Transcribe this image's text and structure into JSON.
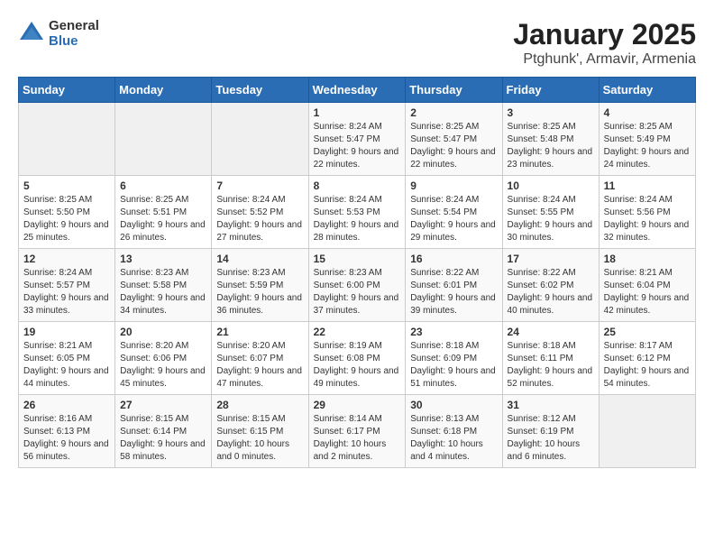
{
  "header": {
    "logo": {
      "general": "General",
      "blue": "Blue"
    },
    "title": "January 2025",
    "subtitle": "Ptghunk', Armavir, Armenia"
  },
  "weekdays": [
    "Sunday",
    "Monday",
    "Tuesday",
    "Wednesday",
    "Thursday",
    "Friday",
    "Saturday"
  ],
  "weeks": [
    [
      {
        "day": "",
        "info": ""
      },
      {
        "day": "",
        "info": ""
      },
      {
        "day": "",
        "info": ""
      },
      {
        "day": "1",
        "info": "Sunrise: 8:24 AM\nSunset: 5:47 PM\nDaylight: 9 hours and 22 minutes."
      },
      {
        "day": "2",
        "info": "Sunrise: 8:25 AM\nSunset: 5:47 PM\nDaylight: 9 hours and 22 minutes."
      },
      {
        "day": "3",
        "info": "Sunrise: 8:25 AM\nSunset: 5:48 PM\nDaylight: 9 hours and 23 minutes."
      },
      {
        "day": "4",
        "info": "Sunrise: 8:25 AM\nSunset: 5:49 PM\nDaylight: 9 hours and 24 minutes."
      }
    ],
    [
      {
        "day": "5",
        "info": "Sunrise: 8:25 AM\nSunset: 5:50 PM\nDaylight: 9 hours and 25 minutes."
      },
      {
        "day": "6",
        "info": "Sunrise: 8:25 AM\nSunset: 5:51 PM\nDaylight: 9 hours and 26 minutes."
      },
      {
        "day": "7",
        "info": "Sunrise: 8:24 AM\nSunset: 5:52 PM\nDaylight: 9 hours and 27 minutes."
      },
      {
        "day": "8",
        "info": "Sunrise: 8:24 AM\nSunset: 5:53 PM\nDaylight: 9 hours and 28 minutes."
      },
      {
        "day": "9",
        "info": "Sunrise: 8:24 AM\nSunset: 5:54 PM\nDaylight: 9 hours and 29 minutes."
      },
      {
        "day": "10",
        "info": "Sunrise: 8:24 AM\nSunset: 5:55 PM\nDaylight: 9 hours and 30 minutes."
      },
      {
        "day": "11",
        "info": "Sunrise: 8:24 AM\nSunset: 5:56 PM\nDaylight: 9 hours and 32 minutes."
      }
    ],
    [
      {
        "day": "12",
        "info": "Sunrise: 8:24 AM\nSunset: 5:57 PM\nDaylight: 9 hours and 33 minutes."
      },
      {
        "day": "13",
        "info": "Sunrise: 8:23 AM\nSunset: 5:58 PM\nDaylight: 9 hours and 34 minutes."
      },
      {
        "day": "14",
        "info": "Sunrise: 8:23 AM\nSunset: 5:59 PM\nDaylight: 9 hours and 36 minutes."
      },
      {
        "day": "15",
        "info": "Sunrise: 8:23 AM\nSunset: 6:00 PM\nDaylight: 9 hours and 37 minutes."
      },
      {
        "day": "16",
        "info": "Sunrise: 8:22 AM\nSunset: 6:01 PM\nDaylight: 9 hours and 39 minutes."
      },
      {
        "day": "17",
        "info": "Sunrise: 8:22 AM\nSunset: 6:02 PM\nDaylight: 9 hours and 40 minutes."
      },
      {
        "day": "18",
        "info": "Sunrise: 8:21 AM\nSunset: 6:04 PM\nDaylight: 9 hours and 42 minutes."
      }
    ],
    [
      {
        "day": "19",
        "info": "Sunrise: 8:21 AM\nSunset: 6:05 PM\nDaylight: 9 hours and 44 minutes."
      },
      {
        "day": "20",
        "info": "Sunrise: 8:20 AM\nSunset: 6:06 PM\nDaylight: 9 hours and 45 minutes."
      },
      {
        "day": "21",
        "info": "Sunrise: 8:20 AM\nSunset: 6:07 PM\nDaylight: 9 hours and 47 minutes."
      },
      {
        "day": "22",
        "info": "Sunrise: 8:19 AM\nSunset: 6:08 PM\nDaylight: 9 hours and 49 minutes."
      },
      {
        "day": "23",
        "info": "Sunrise: 8:18 AM\nSunset: 6:09 PM\nDaylight: 9 hours and 51 minutes."
      },
      {
        "day": "24",
        "info": "Sunrise: 8:18 AM\nSunset: 6:11 PM\nDaylight: 9 hours and 52 minutes."
      },
      {
        "day": "25",
        "info": "Sunrise: 8:17 AM\nSunset: 6:12 PM\nDaylight: 9 hours and 54 minutes."
      }
    ],
    [
      {
        "day": "26",
        "info": "Sunrise: 8:16 AM\nSunset: 6:13 PM\nDaylight: 9 hours and 56 minutes."
      },
      {
        "day": "27",
        "info": "Sunrise: 8:15 AM\nSunset: 6:14 PM\nDaylight: 9 hours and 58 minutes."
      },
      {
        "day": "28",
        "info": "Sunrise: 8:15 AM\nSunset: 6:15 PM\nDaylight: 10 hours and 0 minutes."
      },
      {
        "day": "29",
        "info": "Sunrise: 8:14 AM\nSunset: 6:17 PM\nDaylight: 10 hours and 2 minutes."
      },
      {
        "day": "30",
        "info": "Sunrise: 8:13 AM\nSunset: 6:18 PM\nDaylight: 10 hours and 4 minutes."
      },
      {
        "day": "31",
        "info": "Sunrise: 8:12 AM\nSunset: 6:19 PM\nDaylight: 10 hours and 6 minutes."
      },
      {
        "day": "",
        "info": ""
      }
    ]
  ]
}
